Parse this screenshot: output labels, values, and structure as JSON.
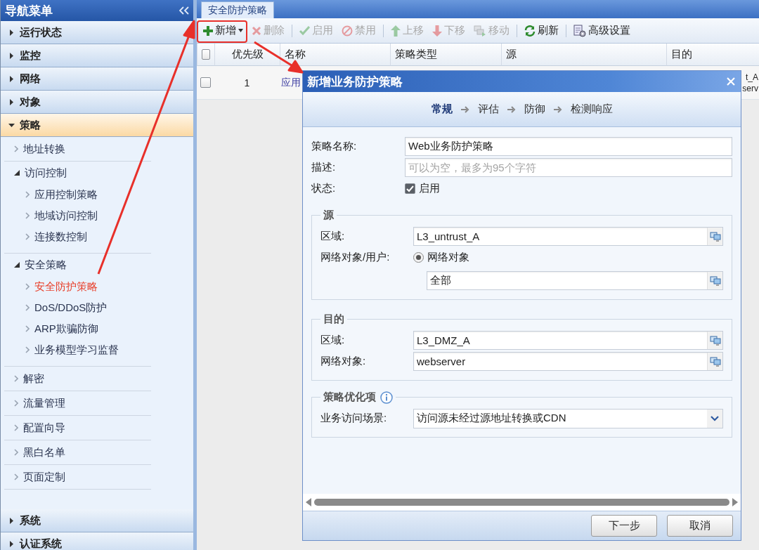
{
  "sidebar": {
    "title": "导航菜单",
    "sections": [
      {
        "label": "运行状态",
        "expanded": false
      },
      {
        "label": "监控",
        "expanded": false
      },
      {
        "label": "网络",
        "expanded": false
      },
      {
        "label": "对象",
        "expanded": false
      },
      {
        "label": "策略",
        "expanded": true,
        "children": [
          {
            "label": "地址转换",
            "selected": false
          },
          {
            "label": "访问控制",
            "expanded": true,
            "children": [
              {
                "label": "应用控制策略",
                "selected": false
              },
              {
                "label": "地域访问控制",
                "selected": false
              },
              {
                "label": "连接数控制",
                "selected": false
              }
            ]
          },
          {
            "label": "安全策略",
            "expanded": true,
            "children": [
              {
                "label": "安全防护策略",
                "selected": true
              },
              {
                "label": "DoS/DDoS防护",
                "selected": false
              },
              {
                "label": "ARP欺骗防御",
                "selected": false
              },
              {
                "label": "业务模型学习监督",
                "selected": false
              }
            ]
          },
          {
            "label": "解密",
            "selected": false
          },
          {
            "label": "流量管理",
            "selected": false
          },
          {
            "label": "配置向导",
            "selected": false
          },
          {
            "label": "黑白名单",
            "selected": false
          },
          {
            "label": "页面定制",
            "selected": false
          }
        ]
      },
      {
        "label": "系统",
        "expanded": false
      },
      {
        "label": "认证系统",
        "expanded": false
      }
    ]
  },
  "tabs": [
    {
      "label": "安全防护策略",
      "selected": true
    }
  ],
  "toolbar": [
    [
      {
        "label": "新增",
        "disabled": false,
        "dropdown": true
      },
      {
        "label": "删除",
        "disabled": true
      }
    ],
    [
      {
        "label": "启用",
        "disabled": true
      },
      {
        "label": "禁用",
        "disabled": true
      }
    ],
    [
      {
        "label": "上移",
        "disabled": true
      },
      {
        "label": "下移",
        "disabled": true
      },
      {
        "label": "移动",
        "disabled": true
      }
    ],
    [
      {
        "label": "刷新",
        "disabled": false
      }
    ],
    [
      {
        "label": "高级设置",
        "disabled": false
      }
    ]
  ],
  "table": {
    "header_checked": false,
    "columns": [
      "优先级",
      "名称",
      "策略类型",
      "源",
      "目的"
    ],
    "rows": [
      {
        "checked": false,
        "priority": "1",
        "name": "应用",
        "destination": [
          "t_A",
          "serv"
        ]
      }
    ]
  },
  "dialog": {
    "title": "新增业务防护策略",
    "steps": [
      {
        "label": "常规",
        "selected": true
      },
      {
        "label": "评估",
        "selected": false
      },
      {
        "label": "防御",
        "selected": false
      },
      {
        "label": "检测响应",
        "selected": false
      }
    ],
    "name": {
      "label": "策略名称:",
      "value": "Web业务防护策略"
    },
    "description": {
      "label": "描述:",
      "placeholder": "可以为空，最多为95个字符"
    },
    "status": {
      "label": "状态:",
      "checked": true,
      "text": "启用"
    },
    "source": {
      "legend": "源",
      "zone": {
        "label": "区域:",
        "value": "L3_untrust_A"
      },
      "object": {
        "label": "网络对象/用户:",
        "option": "网络对象",
        "selected": true,
        "value": "全部"
      }
    },
    "destination": {
      "legend": "目的",
      "zone": {
        "label": "区域:",
        "value": "L3_DMZ_A"
      },
      "object": {
        "label": "网络对象:",
        "value": "webserver"
      }
    },
    "optimization": {
      "legend": "策略优化项",
      "scenario": {
        "label": "业务访问场景:",
        "value": "访问源未经过源地址转换或CDN"
      }
    },
    "buttons": [
      "下一步",
      "取消"
    ]
  }
}
